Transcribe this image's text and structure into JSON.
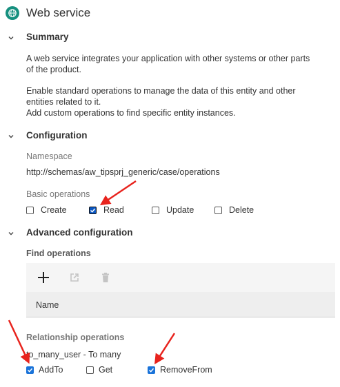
{
  "header": {
    "title": "Web service",
    "icon": "globe-icon",
    "accent": "#16907f"
  },
  "summary": {
    "title": "Summary",
    "text1_line1": "A web service integrates your application with other systems or other parts",
    "text1_line2": "of the product.",
    "text2_line1": "Enable standard operations to manage the data of this entity and other",
    "text2_line2": "entities related to it.",
    "text2_line3": "Add custom operations to find specific entity instances."
  },
  "configuration": {
    "title": "Configuration",
    "namespace_label": "Namespace",
    "namespace_value": "http://schemas/aw_tipsprj_generic/case/operations",
    "basic_operations_label": "Basic operations",
    "operations": [
      {
        "label": "Create",
        "checked": false
      },
      {
        "label": "Read",
        "checked": true
      },
      {
        "label": "Update",
        "checked": false
      },
      {
        "label": "Delete",
        "checked": false
      }
    ]
  },
  "advanced": {
    "title": "Advanced configuration",
    "find_operations_label": "Find operations",
    "table_header_name": "Name",
    "relationship_operations_label": "Relationship operations",
    "relationship_name": "to_many_user - To many",
    "relationship_ops": [
      {
        "label": "AddTo",
        "checked": true
      },
      {
        "label": "Get",
        "checked": false
      },
      {
        "label": "RemoveFrom",
        "checked": true
      }
    ]
  },
  "colors": {
    "annotation_arrow": "#e8231d",
    "checkbox_checked": "#1a73d9"
  }
}
